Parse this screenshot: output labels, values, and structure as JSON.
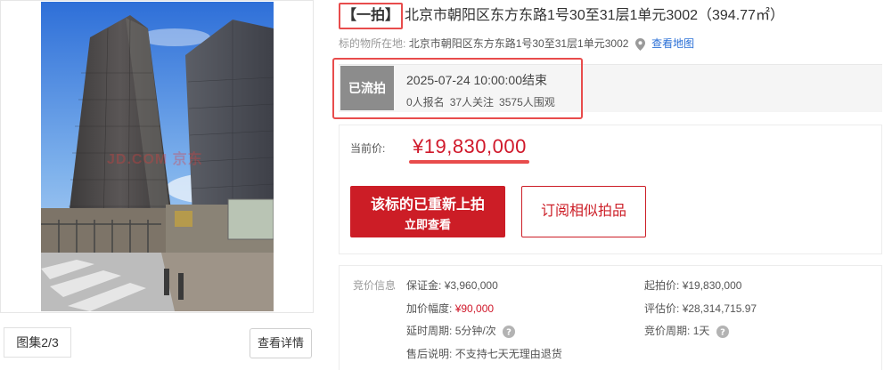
{
  "gallery": {
    "watermark": "JD.COM 京东",
    "counter": "图集2/3",
    "detail_button": "查看详情"
  },
  "listing": {
    "auction_tag": "【一拍】",
    "title": "北京市朝阳区东方东路1号30至31层1单元3002（394.77㎡）",
    "location_label": "标的物所在地:",
    "location": "北京市朝阳区东方东路1号30至31层1单元3002",
    "map_link": "查看地图"
  },
  "status": {
    "badge": "已流拍",
    "end_time": "2025-07-24 10:00:00结束",
    "registered": "0人报名",
    "followers": "37人关注",
    "watchers": "3575人围观"
  },
  "price": {
    "label": "当前价:",
    "value": "¥19,830,000",
    "relist_main": "该标的已重新上拍",
    "relist_sub": "立即查看",
    "subscribe": "订阅相似拍品"
  },
  "bidding": {
    "section_label": "竞价信息",
    "deposit_label": "保证金:",
    "deposit_value": "¥3,960,000",
    "increment_label": "加价幅度:",
    "increment_value": "¥90,000",
    "delay_label": "延时周期:",
    "delay_value": "5分钟/次",
    "aftersale_label": "售后说明:",
    "aftersale_value": "不支持七天无理由退货",
    "start_label": "起拍价:",
    "start_value": "¥19,830,000",
    "appraisal_label": "评估价:",
    "appraisal_value": "¥28,314,715.97",
    "period_label": "竞价周期:",
    "period_value": "1天"
  },
  "colors": {
    "accent_red": "#cc1d26",
    "price_red": "#d0182a",
    "highlight_outline": "#e84c4c",
    "badge_gray": "#8c8c8c",
    "link_blue": "#2a6fd6"
  }
}
